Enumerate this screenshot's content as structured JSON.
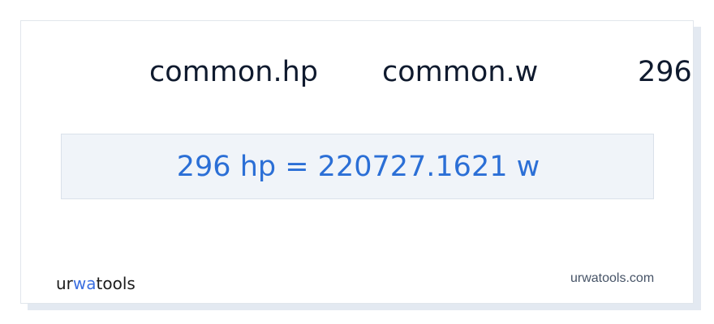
{
  "converter": {
    "from_unit": "common.hp",
    "to_unit": "common.w",
    "amount": "296",
    "result": "296 hp = 220727.1621 w"
  },
  "footer": {
    "logo": {
      "prefix": "ur",
      "accent": "wa",
      "suffix": "tools"
    },
    "site": "urwatools.com"
  },
  "colors": {
    "result_text": "#2b6fd6",
    "result_background": "#f0f4f9",
    "logo_accent": "#3b6fe0",
    "label_text": "#0f1a2e"
  }
}
